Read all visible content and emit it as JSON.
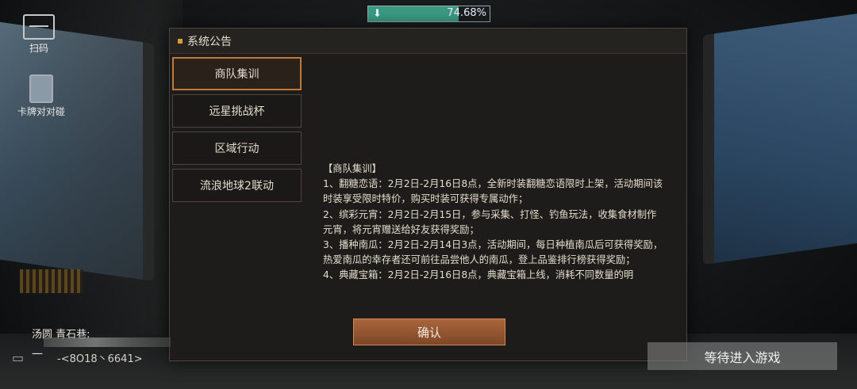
{
  "download": {
    "percent_text": "74.68%",
    "percent": 74.68
  },
  "side": {
    "scan_label": "扫码",
    "cards_label": "卡牌对对碰"
  },
  "dialog": {
    "title": "系统公告",
    "tabs": [
      {
        "label": "商队集训",
        "active": true
      },
      {
        "label": "远星挑战杯",
        "active": false
      },
      {
        "label": "区域行动",
        "active": false
      },
      {
        "label": "流浪地球2联动",
        "active": false
      }
    ],
    "content": {
      "heading": "【商队集训】",
      "lines": [
        "1、翻糖恋语：2月2日-2月16日8点，全新时装翻糖恋语限时上架，活动期间该时装享受限时特价，购买时装可获得专属动作；",
        "2、缤彩元宵：2月2日-2月15日，参与采集、打怪、钓鱼玩法，收集食材制作元宵，将元宵赠送给好友获得奖励；",
        "3、播种南瓜：2月2日-2月14日3点，活动期间，每日种植南瓜后可获得奖励，热爱南瓜的幸存者还可前往品尝他人的南瓜，登上品鉴排行榜获得奖励；",
        "4、典藏宝箱：2月2日-2月16日8点，典藏宝箱上线，消耗不同数量的明"
      ]
    },
    "confirm_label": "确认"
  },
  "chat": {
    "name": "汤圆 青石巷:",
    "dash": "一",
    "message": "-<8O18丶6641>"
  },
  "wait_label": "等待进入游戏",
  "colors": {
    "accent": "#c17a3c",
    "progress": "#3c9a82"
  }
}
